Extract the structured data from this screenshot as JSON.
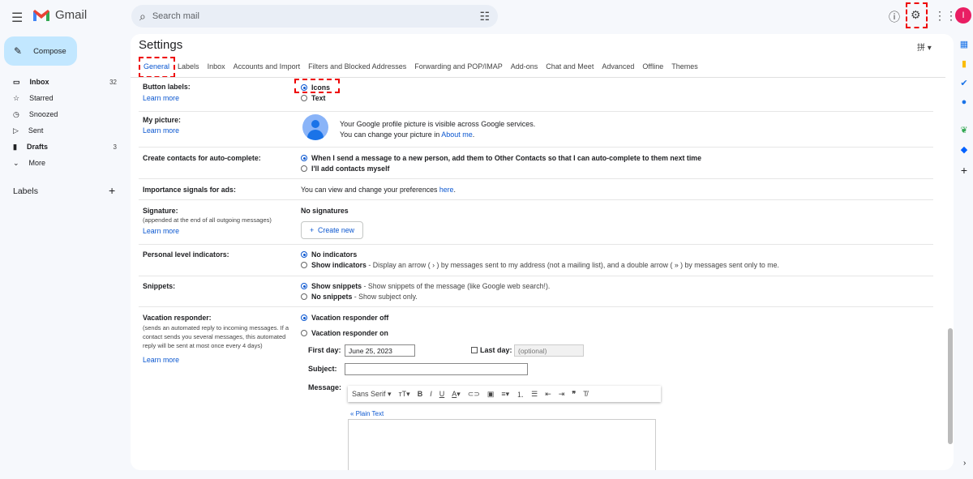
{
  "app": {
    "name": "Gmail",
    "search_placeholder": "Search mail",
    "avatar_letter": "I"
  },
  "sidebar": {
    "compose": "Compose",
    "items": [
      {
        "label": "Inbox",
        "count": "32"
      },
      {
        "label": "Starred"
      },
      {
        "label": "Snoozed"
      },
      {
        "label": "Sent"
      },
      {
        "label": "Drafts",
        "count": "3"
      },
      {
        "label": "More"
      }
    ],
    "labels_header": "Labels"
  },
  "settings": {
    "title": "Settings",
    "tabs": [
      "General",
      "Labels",
      "Inbox",
      "Accounts and Import",
      "Filters and Blocked Addresses",
      "Forwarding and POP/IMAP",
      "Add-ons",
      "Chat and Meet",
      "Advanced",
      "Offline",
      "Themes"
    ],
    "learn_more": "Learn more",
    "button_labels": {
      "label": "Button labels:",
      "opt1": "Icons",
      "opt2": "Text"
    },
    "my_picture": {
      "label": "My picture:",
      "line1": "Your Google profile picture is visible across Google services.",
      "line2": "You can change your picture in ",
      "link": "About me",
      "end": "."
    },
    "contacts": {
      "label": "Create contacts for auto-complete:",
      "opt1": "When I send a message to a new person, add them to Other Contacts so that I can auto-complete to them next time",
      "opt2": "I'll add contacts myself"
    },
    "importance": {
      "label": "Importance signals for ads:",
      "text": "You can view and change your preferences ",
      "link": "here",
      "end": "."
    },
    "signature": {
      "label": "Signature:",
      "sub": "(appended at the end of all outgoing messages)",
      "none": "No signatures",
      "create": "Create new"
    },
    "personal": {
      "label": "Personal level indicators:",
      "opt1": "No indicators",
      "opt2": "Show indicators",
      "opt2_desc": " - Display an arrow ( › ) by messages sent to my address (not a mailing list), and a double arrow ( » ) by messages sent only to me."
    },
    "snippets": {
      "label": "Snippets:",
      "opt1": "Show snippets",
      "opt1_desc": " - Show snippets of the message (like Google web search!).",
      "opt2": "No snippets",
      "opt2_desc": " - Show subject only."
    },
    "vacation": {
      "label": "Vacation responder:",
      "sub": "(sends an automated reply to incoming messages. If a contact sends you several messages, this automated reply will be sent at most once every 4 days)",
      "opt1": "Vacation responder off",
      "opt2": "Vacation responder on",
      "first_day_label": "First day:",
      "first_day": "June 25, 2023",
      "last_day_label": "Last day:",
      "last_day_placeholder": "(optional)",
      "subject_label": "Subject:",
      "message_label": "Message:",
      "font": "Sans Serif",
      "plain_text": "« Plain Text"
    }
  }
}
